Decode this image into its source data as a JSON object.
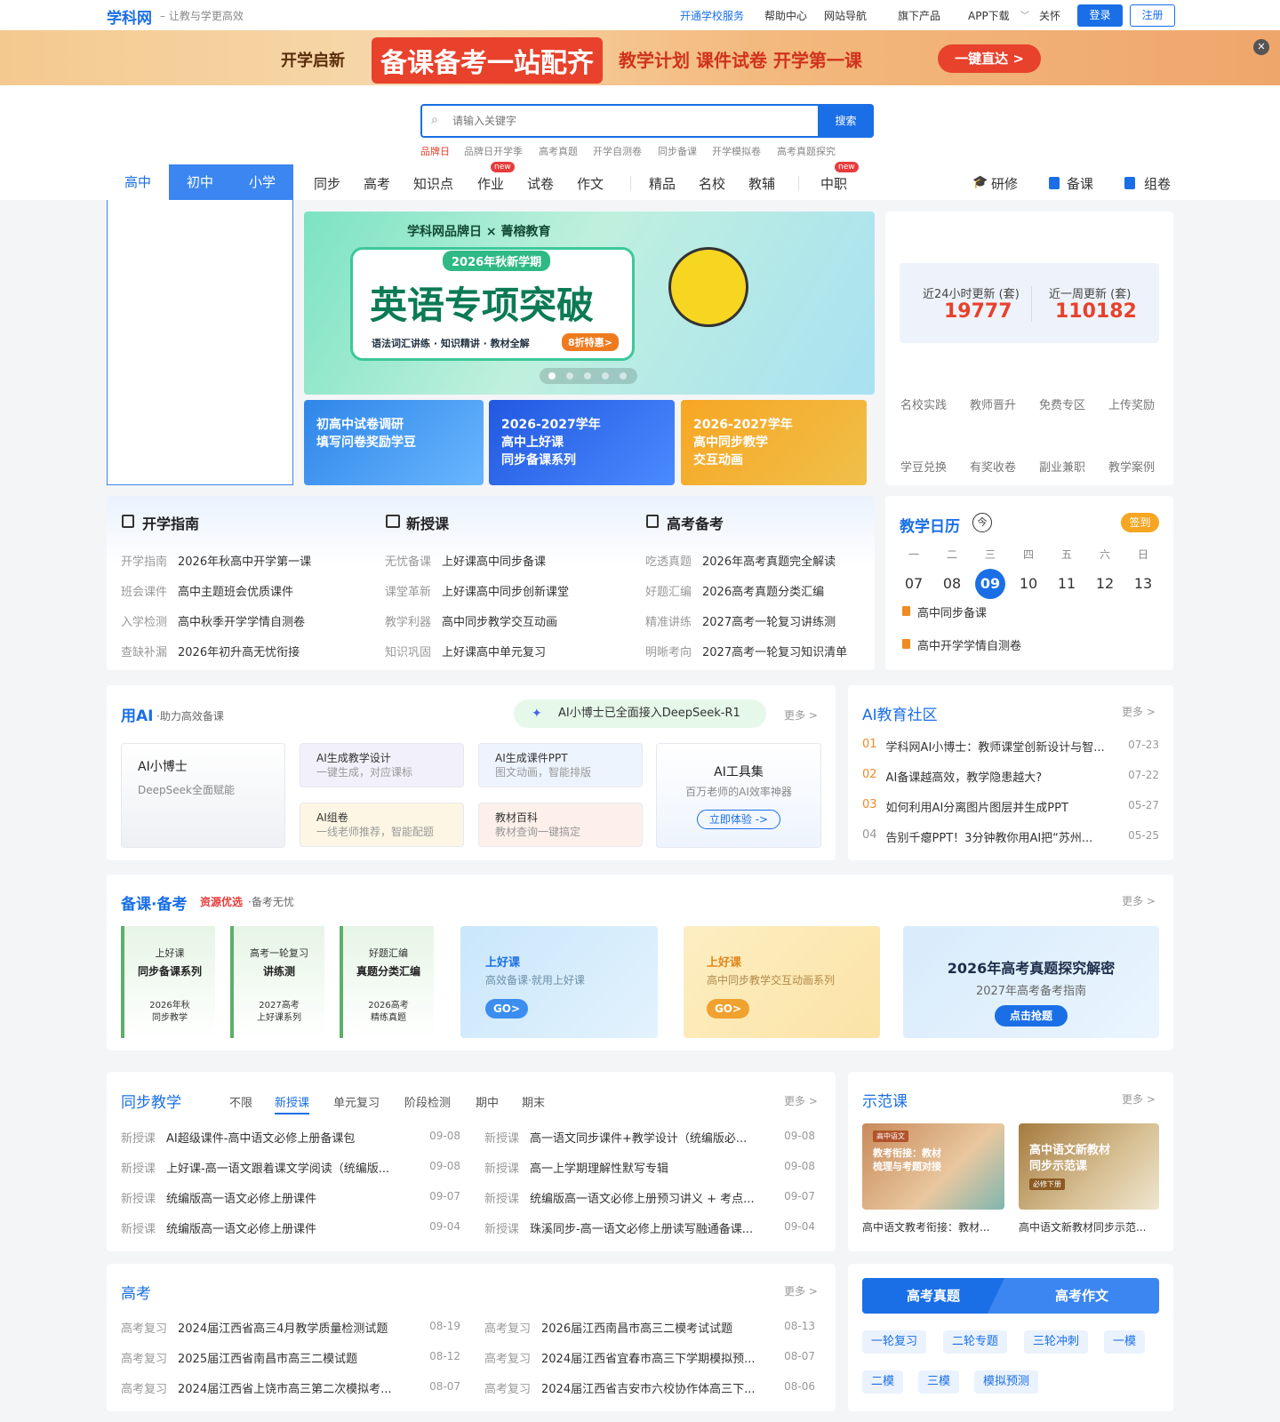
{
  "header": {
    "logo": "学科网",
    "slogan": "– 让教与学更高效",
    "links": [
      "开通学校服务",
      "帮助中心",
      "网站导航",
      "旗下产品",
      "APP下载",
      "关怀"
    ],
    "login": "登录",
    "register": "注册"
  },
  "promo": {
    "tag1": "开学启新",
    "headline": "备课备考一站配齐",
    "items": "教学计划  课件试卷  开学第一课",
    "cta": "一键直达 >"
  },
  "search": {
    "placeholder": "请输入关键字",
    "button": "搜索",
    "hot": [
      "品牌日",
      "品牌日开学季",
      "高考真题",
      "开学自测卷",
      "同步备课",
      "开学模拟卷",
      "高考真题探究"
    ]
  },
  "stages": [
    "高中",
    "初中",
    "小学"
  ],
  "nav": {
    "main": [
      "同步",
      "高考",
      "知识点",
      "作业",
      "试卷",
      "作文",
      "精品",
      "名校",
      "教辅",
      "中职"
    ],
    "new_badge": "new",
    "right": [
      "研修",
      "备课",
      "组卷"
    ]
  },
  "banner": {
    "brand": "学科网品牌日 × 菁榕教育",
    "term": "2026年秋新学期",
    "title": "英语专项突破",
    "sub": "语法词汇讲练 · 知识精讲 · 教材全解",
    "discount": "8折特惠>",
    "small": [
      "初高中试卷调研\n填写问卷奖励学豆",
      "2026-2027学年\n高中上好课\n同步备课系列",
      "2026-2027学年\n高中同步教学\n交互动画"
    ]
  },
  "stats": {
    "day_label": "近24小时更新 (套)",
    "day_value": "19777",
    "week_label": "近一周更新 (套)",
    "week_value": "110182"
  },
  "quick_links": [
    "名校实践",
    "教师晋升",
    "免费专区",
    "上传奖励",
    "学豆兑换",
    "有奖收卷",
    "副业兼职",
    "教学案例"
  ],
  "guides": [
    {
      "title": "开学指南",
      "rows": [
        [
          "开学指南",
          "2026年秋高中开学第一课"
        ],
        [
          "班会课件",
          "高中主题班会优质课件"
        ],
        [
          "入学检测",
          "高中秋季开学学情自测卷"
        ],
        [
          "查缺补漏",
          "2026年初升高无忧衔接"
        ]
      ]
    },
    {
      "title": "新授课",
      "rows": [
        [
          "无忧备课",
          "上好课高中同步备课"
        ],
        [
          "课堂革新",
          "上好课高中同步创新课堂"
        ],
        [
          "教学利器",
          "高中同步教学交互动画"
        ],
        [
          "知识巩固",
          "上好课高中单元复习"
        ]
      ]
    },
    {
      "title": "高考备考",
      "rows": [
        [
          "吃透真题",
          "2026年高考真题完全解读"
        ],
        [
          "好题汇编",
          "2026高考真题分类汇编"
        ],
        [
          "精准讲练",
          "2027高考一轮复习讲练测"
        ],
        [
          "明晰考向",
          "2027高考一轮复习知识清单"
        ]
      ]
    }
  ],
  "calendar": {
    "title": "教学日历",
    "today_mark": "今",
    "checkin": "签到",
    "weekdays": [
      "一",
      "二",
      "三",
      "四",
      "五",
      "六",
      "日"
    ],
    "dates": [
      "07",
      "08",
      "09",
      "10",
      "11",
      "12",
      "13"
    ],
    "events": [
      "高中同步备课",
      "高中开学学情自测卷"
    ]
  },
  "ai": {
    "title": "用AI",
    "subtitle": "·助力高效备课",
    "pill": "AI小博士已全面接入DeepSeek-R1",
    "more": "更多 >",
    "doctor_title": "AI小博士",
    "doctor_sub": "DeepSeek全面赋能",
    "tiles": [
      {
        "t": "AI生成教学设计",
        "s": "一键生成，对应课标"
      },
      {
        "t": "AI生成课件PPT",
        "s": "图文动画，智能排版"
      },
      {
        "t": "AI组卷",
        "s": "一线老师推荐，智能配题"
      },
      {
        "t": "教材百科",
        "s": "教材查询一键搞定"
      }
    ],
    "tools_title": "AI工具集",
    "tools_sub": "百万老师的AI效率神器",
    "tools_btn": "立即体验 ->"
  },
  "community": {
    "title": "AI教育社区",
    "more": "更多 >",
    "items": [
      {
        "n": "01",
        "t": "学科网AI小博士：教师课堂创新设计与智...",
        "d": "07-23"
      },
      {
        "n": "02",
        "t": "AI备课越高效，教学隐患越大?",
        "d": "07-22"
      },
      {
        "n": "03",
        "t": "如何利用AI分离图片图层并生成PPT",
        "d": "05-27"
      },
      {
        "n": "04",
        "t": "告别千瘪PPT！3分钟教你用AI把“苏州...",
        "d": "05-25"
      }
    ]
  },
  "prep": {
    "title": "备课·备考",
    "slogan_red": "资源优选",
    "slogan": "·备考无忧",
    "more": "更多 >",
    "books": [
      {
        "top": "上好课",
        "main": "同步备课系列",
        "foot": "2026年秋\n同步教学"
      },
      {
        "top": "高考一轮复习",
        "main": "讲练测",
        "foot": "2027高考\n上好课系列"
      },
      {
        "top": "好题汇编",
        "main": "真题分类汇编",
        "foot": "2026高考\n精练真题"
      }
    ],
    "card1": {
      "t": "上好课",
      "s": "高效备课·就用上好课",
      "go": "GO>"
    },
    "card2": {
      "t": "上好课",
      "s": "高中同步教学交互动画系列",
      "go": "GO>"
    },
    "card3": {
      "t": "2026年高考真题探究解密",
      "s": "2027年高考备考指南",
      "btn": "点击抢题"
    }
  },
  "sync": {
    "title": "同步教学",
    "tabs": [
      "不限",
      "新授课",
      "单元复习",
      "阶段检测",
      "期中",
      "期末"
    ],
    "more": "更多 >",
    "left": [
      {
        "k": "新授课",
        "t": "AI超级课件-高中语文必修上册备课包",
        "d": "09-08"
      },
      {
        "k": "新授课",
        "t": "上好课-高一语文跟着课文学阅读（统编版...",
        "d": "09-08"
      },
      {
        "k": "新授课",
        "t": "统编版高一语文必修上册课件",
        "d": "09-07"
      },
      {
        "k": "新授课",
        "t": "统编版高一语文必修上册课件",
        "d": "09-04"
      }
    ],
    "right": [
      {
        "k": "新授课",
        "t": "高一语文同步课件+教学设计（统编版必...",
        "d": "09-08"
      },
      {
        "k": "新授课",
        "t": "高一上学期理解性默写专辑",
        "d": "09-08"
      },
      {
        "k": "新授课",
        "t": "统编版高一语文必修上册预习讲义 + 考点...",
        "d": "09-07"
      },
      {
        "k": "新授课",
        "t": "珠溪同步-高一语文必修上册读写融通备课...",
        "d": "09-04"
      }
    ]
  },
  "demo": {
    "title": "示范课",
    "more": "更多 >",
    "items": [
      {
        "img": "教考衔接：教材\n梳理与考题对接",
        "tag": "高中语文",
        "cap": "高中语文教考衔接：教材..."
      },
      {
        "img": "高中语文新教材\n同步示范课",
        "tag": "必修下册",
        "cap": "高中语文新教材同步示范..."
      }
    ]
  },
  "gaokao": {
    "title": "高考",
    "more": "更多 >",
    "left": [
      {
        "k": "高考复习",
        "t": "2024届江西省高三4月教学质量检测试题",
        "d": "08-19"
      },
      {
        "k": "高考复习",
        "t": "2025届江西省南昌市高三二模试题",
        "d": "08-12"
      },
      {
        "k": "高考复习",
        "t": "2024届江西省上饶市高三第二次模拟考...",
        "d": "08-07"
      }
    ],
    "right": [
      {
        "k": "高考复习",
        "t": "2026届江西南昌市高三二模考试试题",
        "d": "08-13"
      },
      {
        "k": "高考复习",
        "t": "2024届江西省宜春市高三下学期模拟预...",
        "d": "08-07"
      },
      {
        "k": "高考复习",
        "t": "2024届江西省吉安市六校协作体高三下...",
        "d": "08-06"
      }
    ]
  },
  "gk_tabs": {
    "a": "高考真题",
    "b": "高考作文",
    "chips": [
      "一轮复习",
      "二轮专题",
      "三轮冲刺",
      "一模",
      "二模",
      "三模",
      "模拟预测"
    ]
  },
  "colors": {
    "accent": "#1a6fe6",
    "brand_red": "#e63c3c",
    "orange": "#f08a24"
  }
}
